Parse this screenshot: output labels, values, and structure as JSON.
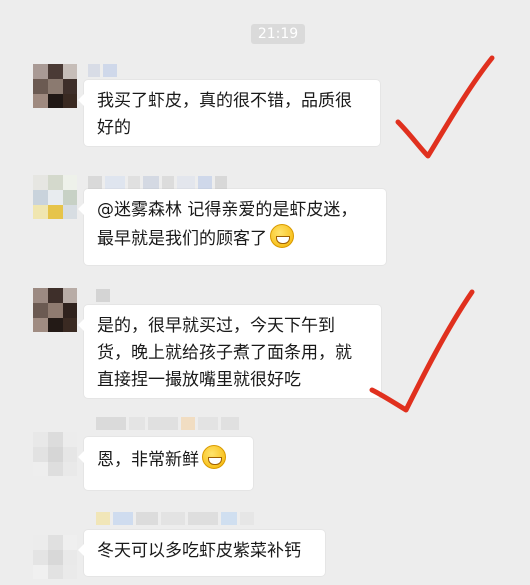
{
  "chat": {
    "timestamp": "21:19",
    "messages": [
      {
        "text": "我买了虾皮，真的很不错，品质很好的"
      },
      {
        "mention": "@迷雾森林",
        "text": " 记得亲爱的是虾皮迷，最早就是我们的顾客了",
        "emoji": "grinning-face-icon"
      },
      {
        "text": "是的，很早就买过，今天下午到货，晚上就给孩子煮了面条用，就直接捏一撮放嘴里就很好吃"
      },
      {
        "text": "恩，非常新鲜",
        "emoji": "yum-face-icon"
      },
      {
        "text": "冬天可以多吃虾皮紫菜补钙"
      }
    ]
  },
  "annotations": {
    "check_color": "#e0301e",
    "marks": [
      "check-mark-icon",
      "check-mark-icon"
    ]
  }
}
